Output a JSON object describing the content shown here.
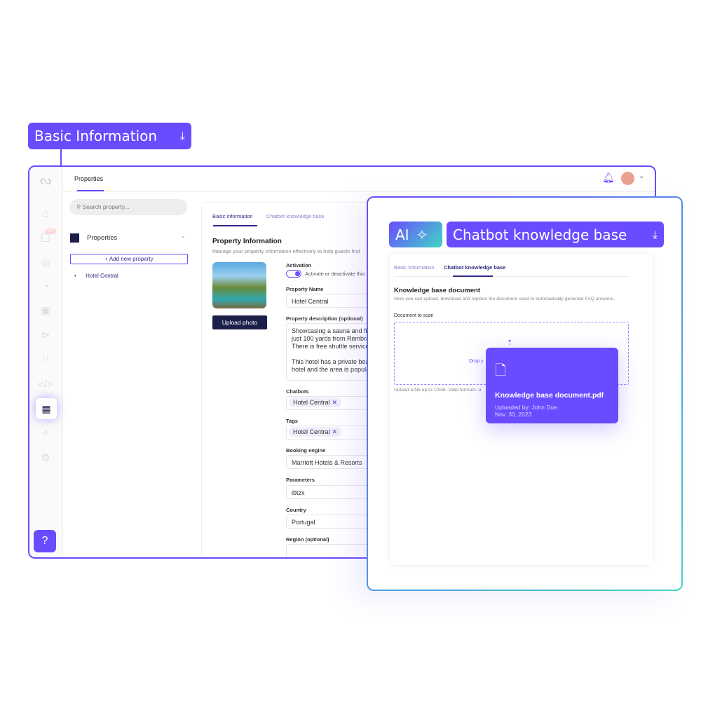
{
  "callouts": {
    "basic": "Basic Information",
    "ai": "AI",
    "chatbot": "Chatbot knowledge base"
  },
  "header": {
    "title": "Properties"
  },
  "sidebar": {
    "badge": "10+"
  },
  "left": {
    "search_placeholder": "Search property...",
    "section": "Properties",
    "add": "+ Add new property",
    "items": [
      "Hotel Central"
    ]
  },
  "tabs": [
    "Basic information",
    "Chatbot knowledge base"
  ],
  "form": {
    "title": "Property Information",
    "subtitle": "Manage your property information effectively to help guests find",
    "upload": "Upload photo",
    "activation_label": "Activation",
    "activation_text": "Activate or deactivate this",
    "activation_on": true,
    "name_label": "Property Name",
    "name": "Hotel Central",
    "desc_label": "Property description (optional)",
    "desc": [
      "Showcasing a sauna and fitr",
      "just 100 yards from Rembra",
      "There is free shuttle service",
      "",
      "This hotel has a private bea",
      "hotel and the area is popula"
    ],
    "chatbots_label": "Chatbots",
    "chatbot_chip": "Hotel Central",
    "tags_label": "Tags",
    "tag_chip": "Hotel Central",
    "booking_label": "Booking engine",
    "booking": "Marriott Hotels & Resorts",
    "params_label": "Parameters",
    "params": "ibtzx",
    "country_label": "Country",
    "country": "Portugal",
    "region_label": "Region (optional)"
  },
  "kb": {
    "title": "Knowledge base document",
    "subtitle": "Here you can upload, download and replace the document used to automatically generate FAQ answers.",
    "doc_label": "Document to scan",
    "drop": "Drop y",
    "hint": "Upload a file up to 10mb. Valid formats: d",
    "file": "Knowledge base document.pdf",
    "uploaded": "Uploaded by: John Doe",
    "date": "Nov. 30, 2023"
  },
  "colors": {
    "accent": "#6b4bff",
    "navy": "#1c1f4a",
    "teal": "#3fd6c6"
  }
}
